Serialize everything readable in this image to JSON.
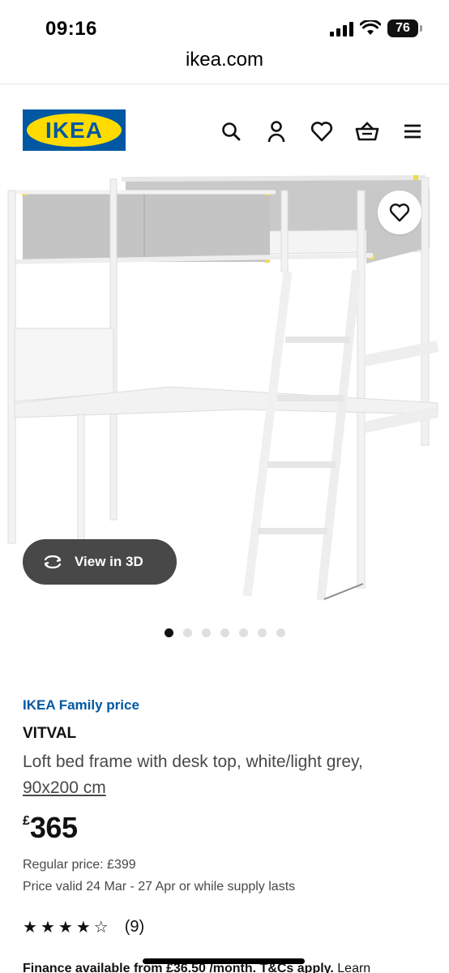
{
  "status": {
    "time": "09:16",
    "battery": "76"
  },
  "browser": {
    "url": "ikea.com"
  },
  "header": {
    "logo_text": "IKEA",
    "icons": [
      "search-icon",
      "user-icon",
      "heart-icon",
      "basket-icon",
      "menu-icon"
    ]
  },
  "gallery": {
    "view_3d_label": "View in 3D",
    "dot_count": 7,
    "active_dot": 0
  },
  "product": {
    "family_price_label": "IKEA Family price",
    "name": "VITVAL",
    "description_line1": "Loft bed frame with desk top, white/light grey,",
    "size": "90x200 cm",
    "currency": "£",
    "price": "365",
    "regular_price": "Regular price: £399",
    "validity": "Price valid 24 Mar - 27 Apr or while supply lasts",
    "rating": {
      "stars": 4,
      "max_stars": 5,
      "count_label": "(9)"
    },
    "finance_text": "Finance available from £36.50 /month. T&Cs apply.",
    "finance_link": "Learn"
  },
  "colors": {
    "ikea_blue": "#0058a3",
    "ikea_yellow": "#ffdb00",
    "pill_bg": "#484848"
  }
}
